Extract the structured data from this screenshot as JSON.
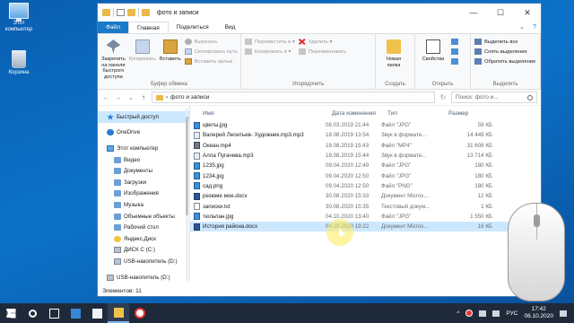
{
  "desktop": {
    "icons": [
      {
        "label": "Этот компьютер",
        "icon": "computer-icon"
      },
      {
        "label": "Корзина",
        "icon": "recycle-bin-icon"
      }
    ]
  },
  "window": {
    "title": "фото и записи",
    "controls": {
      "minimize": "—",
      "maximize": "☐",
      "close": "✕"
    }
  },
  "ribbon_tabs": [
    {
      "label": "Файл"
    },
    {
      "label": "Главная"
    },
    {
      "label": "Поделиться"
    },
    {
      "label": "Вид"
    }
  ],
  "ribbon": {
    "clipboard": {
      "pin_label": "Закрепить на панели быстрого доступа",
      "copy_label": "Копировать",
      "paste_label": "Вставить",
      "cut_label": "Вырезать",
      "copy_path_label": "Скопировать путь",
      "paste_shortcut_label": "Вставить ярлык",
      "group_label": "Буфер обмена"
    },
    "organize": {
      "move_label": "Переместить в ▾",
      "copy_to_label": "Копировать в ▾",
      "delete_label": "Удалить ▾",
      "rename_label": "Переименовать",
      "group_label": "Упорядочить"
    },
    "create": {
      "new_folder_label": "Новая папка",
      "group_label": "Создать"
    },
    "open": {
      "properties_label": "Свойства",
      "group_label": "Открыть"
    },
    "select": {
      "select_all_label": "Выделить все",
      "select_none_label": "Снять выделение",
      "invert_label": "Обратить выделение",
      "group_label": "Выделить"
    }
  },
  "address": {
    "back": "←",
    "forward": "→",
    "up_arrow": "↑",
    "path": "фото и записи",
    "search_placeholder": "Поиск: фото и..."
  },
  "nav_pane": [
    {
      "label": "Быстрый доступ",
      "icon": "star-icon",
      "selected": true,
      "level": 1
    },
    {
      "label": "OneDrive",
      "icon": "cloud-icon",
      "level": 1
    },
    {
      "label": "Этот компьютер",
      "icon": "computer-icon",
      "level": 1
    },
    {
      "label": "Видео",
      "icon": "folder-icon",
      "level": 2
    },
    {
      "label": "Документы",
      "icon": "folder-icon",
      "level": 2
    },
    {
      "label": "Загрузки",
      "icon": "folder-icon",
      "level": 2
    },
    {
      "label": "Изображения",
      "icon": "folder-icon",
      "level": 2
    },
    {
      "label": "Музыка",
      "icon": "folder-icon",
      "level": 2
    },
    {
      "label": "Объемные объекты",
      "icon": "folder-icon",
      "level": 2
    },
    {
      "label": "Рабочий стол",
      "icon": "folder-icon",
      "level": 2
    },
    {
      "label": "Яндекс.Диск",
      "icon": "yandex-disk-icon",
      "level": 2
    },
    {
      "label": "ДИСК С (C:)",
      "icon": "drive-icon",
      "level": 2
    },
    {
      "label": "USB-накопитель (D:)",
      "icon": "drive-icon",
      "level": 2
    },
    {
      "label": "USB-накопитель (D:)",
      "icon": "drive-icon",
      "level": 1
    }
  ],
  "columns": {
    "name": "Имя",
    "date": "Дата изменения",
    "type": "Тип",
    "size": "Размер"
  },
  "files": [
    {
      "name": "цветы.jpg",
      "date": "08.03.2019 21:44",
      "type": "Файл \"JPG\"",
      "size": "59 КБ",
      "kind": "img"
    },
    {
      "name": "Валерий Леонтьев- Художник.mp3.mp3",
      "date": "18.08.2019 13:54",
      "type": "Звук в формате...",
      "size": "14 449 КБ",
      "kind": "mp3"
    },
    {
      "name": "Океан.mp4",
      "date": "18.08.2019 15:43",
      "type": "Файл \"MP4\"",
      "size": "31 608 КБ",
      "kind": "mp4"
    },
    {
      "name": "Алла Пугачева.mp3",
      "date": "18.08.2019 15:44",
      "type": "Звук в формате...",
      "size": "13 714 КБ",
      "kind": "mp3"
    },
    {
      "name": "1235.jpg",
      "date": "09.04.2020 12:49",
      "type": "Файл \"JPG\"",
      "size": "180 КБ",
      "kind": "img"
    },
    {
      "name": "1234.jpg",
      "date": "09.04.2020 12:50",
      "type": "Файл \"JPG\"",
      "size": "180 КБ",
      "kind": "img"
    },
    {
      "name": "сад.png",
      "date": "09.04.2020 12:50",
      "type": "Файл \"PNG\"",
      "size": "180 КБ",
      "kind": "img"
    },
    {
      "name": "резюме мое.docx",
      "date": "30.08.2020 15:33",
      "type": "Документ Micros...",
      "size": "12 КБ",
      "kind": "doc"
    },
    {
      "name": "записки.txt",
      "date": "30.08.2020 15:35",
      "type": "Текстовый докум...",
      "size": "1 КБ",
      "kind": "txt"
    },
    {
      "name": "тюльпан.jpg",
      "date": "04.10.2020 13:40",
      "type": "Файл \"JPG\"",
      "size": "1 550 КБ",
      "kind": "img"
    },
    {
      "name": "История района.docx",
      "date": "04.10.2020 19:22",
      "type": "Документ Micros...",
      "size": "16 КБ",
      "kind": "doc",
      "selected": true
    }
  ],
  "status": {
    "count": "Элементов: 11"
  },
  "taskbar": {
    "time": "17:42",
    "date": "06.10.2020",
    "lang": "РУС",
    "tray_caret": "^"
  }
}
